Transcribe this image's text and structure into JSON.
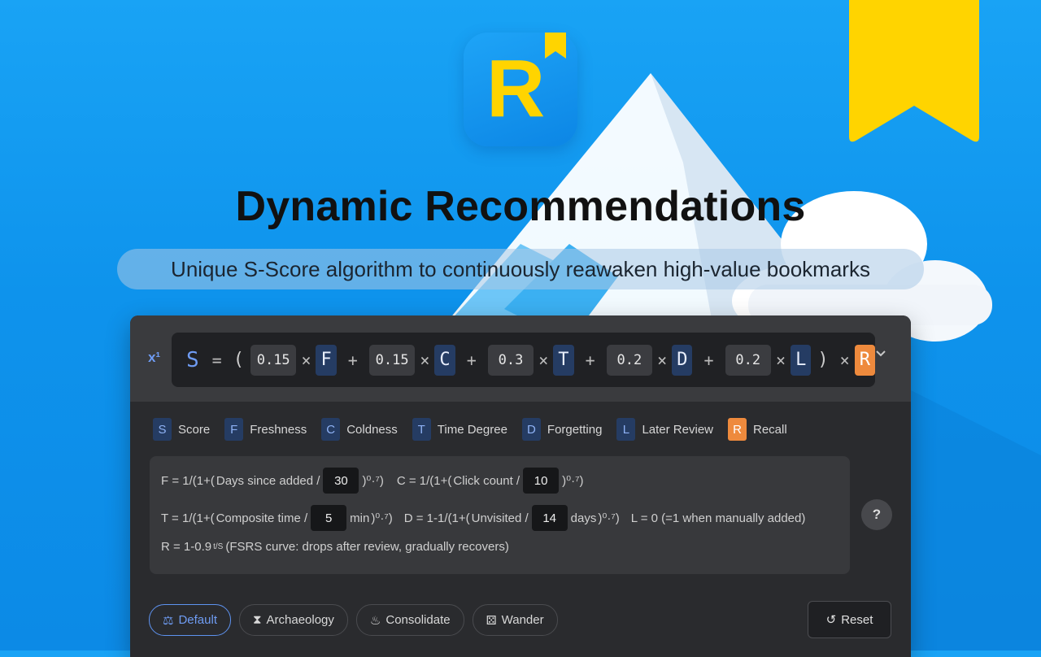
{
  "app_icon": {
    "letter": "R"
  },
  "headline": "Dynamic Recommendations",
  "subtitle": "Unique S-Score algorithm to continuously reawaken high-value bookmarks",
  "formula": {
    "s_letter": "S",
    "equals": "=",
    "open_paren": "(",
    "close_paren": ")",
    "plus": "+",
    "times": "×",
    "terms": [
      {
        "weight": "0.15",
        "letter": "F"
      },
      {
        "weight": "0.15",
        "letter": "C"
      },
      {
        "weight": "0.3",
        "letter": "T"
      },
      {
        "weight": "0.2",
        "letter": "D"
      },
      {
        "weight": "0.2",
        "letter": "L"
      }
    ],
    "recall_letter": "R"
  },
  "legend": [
    {
      "letter": "S",
      "label": "Score"
    },
    {
      "letter": "F",
      "label": "Freshness"
    },
    {
      "letter": "C",
      "label": "Coldness"
    },
    {
      "letter": "T",
      "label": "Time Degree"
    },
    {
      "letter": "D",
      "label": "Forgetting"
    },
    {
      "letter": "L",
      "label": "Later Review"
    },
    {
      "letter": "R",
      "label": "Recall"
    }
  ],
  "definitions": {
    "f_prefix": "F = 1/(1+(",
    "f_label": "Days since added /",
    "f_value": "30",
    "f_suffix": ")⁰·⁷)",
    "c_prefix": "C = 1/(1+(",
    "c_label": "Click count /",
    "c_value": "10",
    "c_suffix": ")⁰·⁷)",
    "t_prefix": "T = 1/(1+(",
    "t_label": "Composite time /",
    "t_value": "5",
    "t_unit": "min",
    "t_suffix": ")⁰·⁷)",
    "d_prefix": "D = 1-1/(1+(",
    "d_label": "Unvisited /",
    "d_value": "14",
    "d_unit": "days",
    "d_suffix": ")⁰·⁷)",
    "l_text": "L = 0 (=1 when manually added)",
    "r_prefix": "R = 1-0.9",
    "r_exp": "t/S",
    "r_text": "(FSRS curve: drops after review, gradually recovers)"
  },
  "presets": [
    {
      "label": "Default",
      "icon": "scale-icon",
      "active": true
    },
    {
      "label": "Archaeology",
      "icon": "hourglass-icon",
      "active": false
    },
    {
      "label": "Consolidate",
      "icon": "flame-icon",
      "active": false
    },
    {
      "label": "Wander",
      "icon": "dice-icon",
      "active": false
    }
  ],
  "reset_label": "Reset",
  "colors": {
    "accent": "#6f9cf3",
    "recall": "#ee8a3d",
    "bookmark": "#ffd400"
  }
}
